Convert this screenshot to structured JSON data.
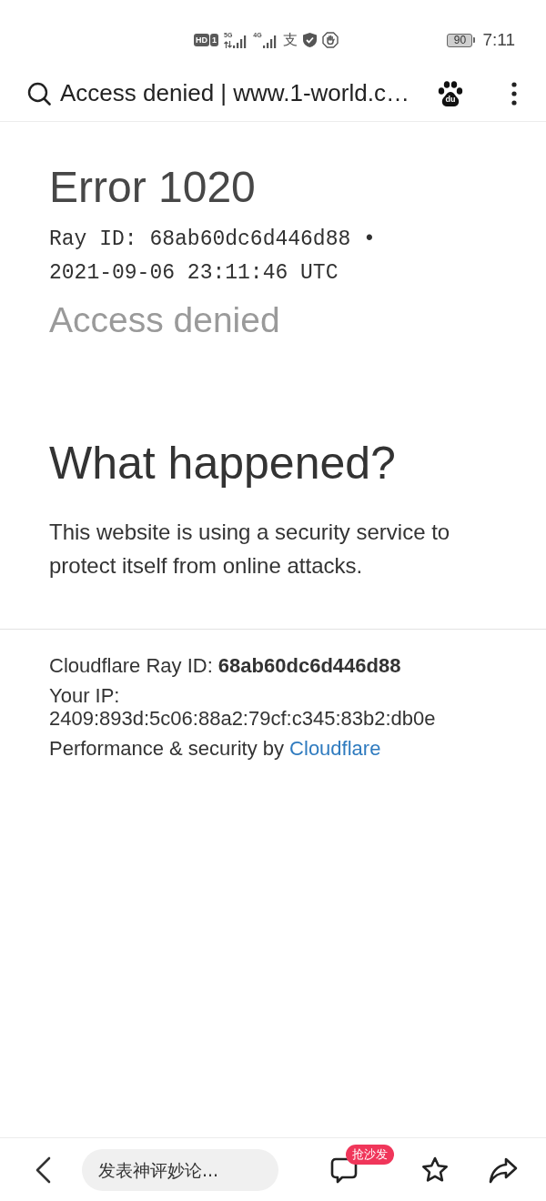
{
  "status_bar": {
    "hd_label": "HD",
    "sim_label": "1",
    "signals": [
      {
        "label": "5G",
        "data_activity": true
      },
      {
        "label": "4G",
        "data_activity": false
      }
    ],
    "glyph": "支",
    "battery": "90",
    "time": "7:11"
  },
  "address_bar": {
    "title": "Access denied | www.1-world.c…",
    "logo_text": "du"
  },
  "error": {
    "title": "Error 1020",
    "ray_id": "Ray ID: 68ab60dc6d446d88 •",
    "timestamp": "2021-09-06 23:11:46 UTC",
    "subtitle": "Access denied"
  },
  "section": {
    "heading": "What happened?",
    "body": "This website is using a security service to protect itself from online attacks."
  },
  "footer": {
    "ray_id": "Cloudflare Ray ID: **68ab60dc6d446d88**",
    "ip_label": "Your IP:",
    "ip": "2409:893d:5c06:88a2:79cf:c345:83b2:db0e",
    "credit": "Performance & security by",
    "credit_link": "Cloudflare"
  },
  "bottom_bar": {
    "placeholder": "发表神评妙论...",
    "comment_badge": "抢沙发"
  }
}
